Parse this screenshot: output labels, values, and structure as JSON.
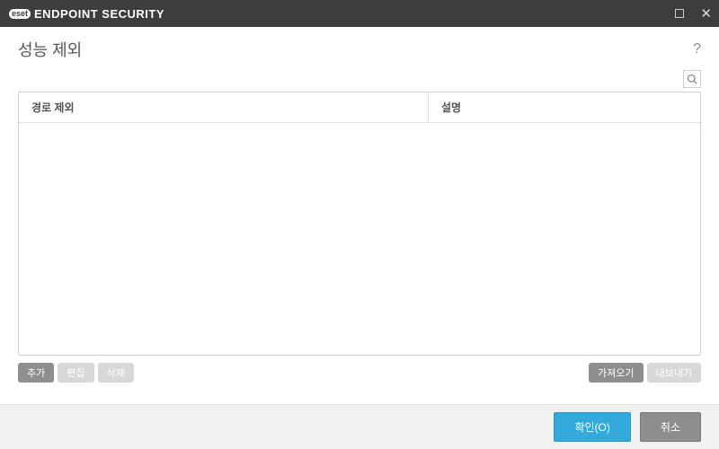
{
  "titlebar": {
    "brand_badge": "eset",
    "app_title": "ENDPOINT SECURITY"
  },
  "subheader": {
    "title": "성능 제외",
    "help": "?"
  },
  "table": {
    "col1": "경로 제외",
    "col2": "설명"
  },
  "actions": {
    "add": "추가",
    "edit": "편집",
    "delete": "삭제",
    "import": "가져오기",
    "export": "내보내기"
  },
  "footer": {
    "ok": "확인(O)",
    "cancel": "취소"
  }
}
